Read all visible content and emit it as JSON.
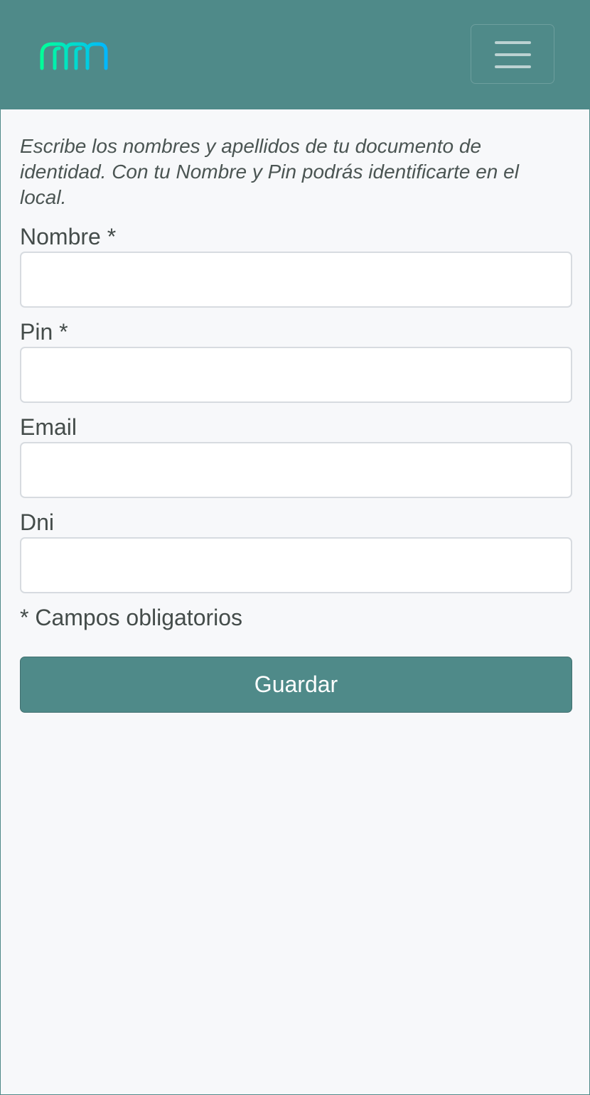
{
  "header": {
    "logo_name": "logo-icon",
    "menu_icon": "hamburger-menu-icon",
    "background_color": "#4f8a89",
    "logo_colors": [
      "#00ff99",
      "#00b8ff"
    ]
  },
  "form": {
    "intro_text": "Escribe los nombres y apellidos de tu documento de identidad. Con tu Nombre y Pin podrás identificarte en el local.",
    "fields": [
      {
        "label": "Nombre *",
        "value": "",
        "placeholder": ""
      },
      {
        "label": "Pin *",
        "value": "",
        "placeholder": ""
      },
      {
        "label": "Email",
        "value": "",
        "placeholder": ""
      },
      {
        "label": "Dni",
        "value": "",
        "placeholder": ""
      }
    ],
    "required_note": "* Campos obligatorios",
    "submit_label": "Guardar"
  }
}
